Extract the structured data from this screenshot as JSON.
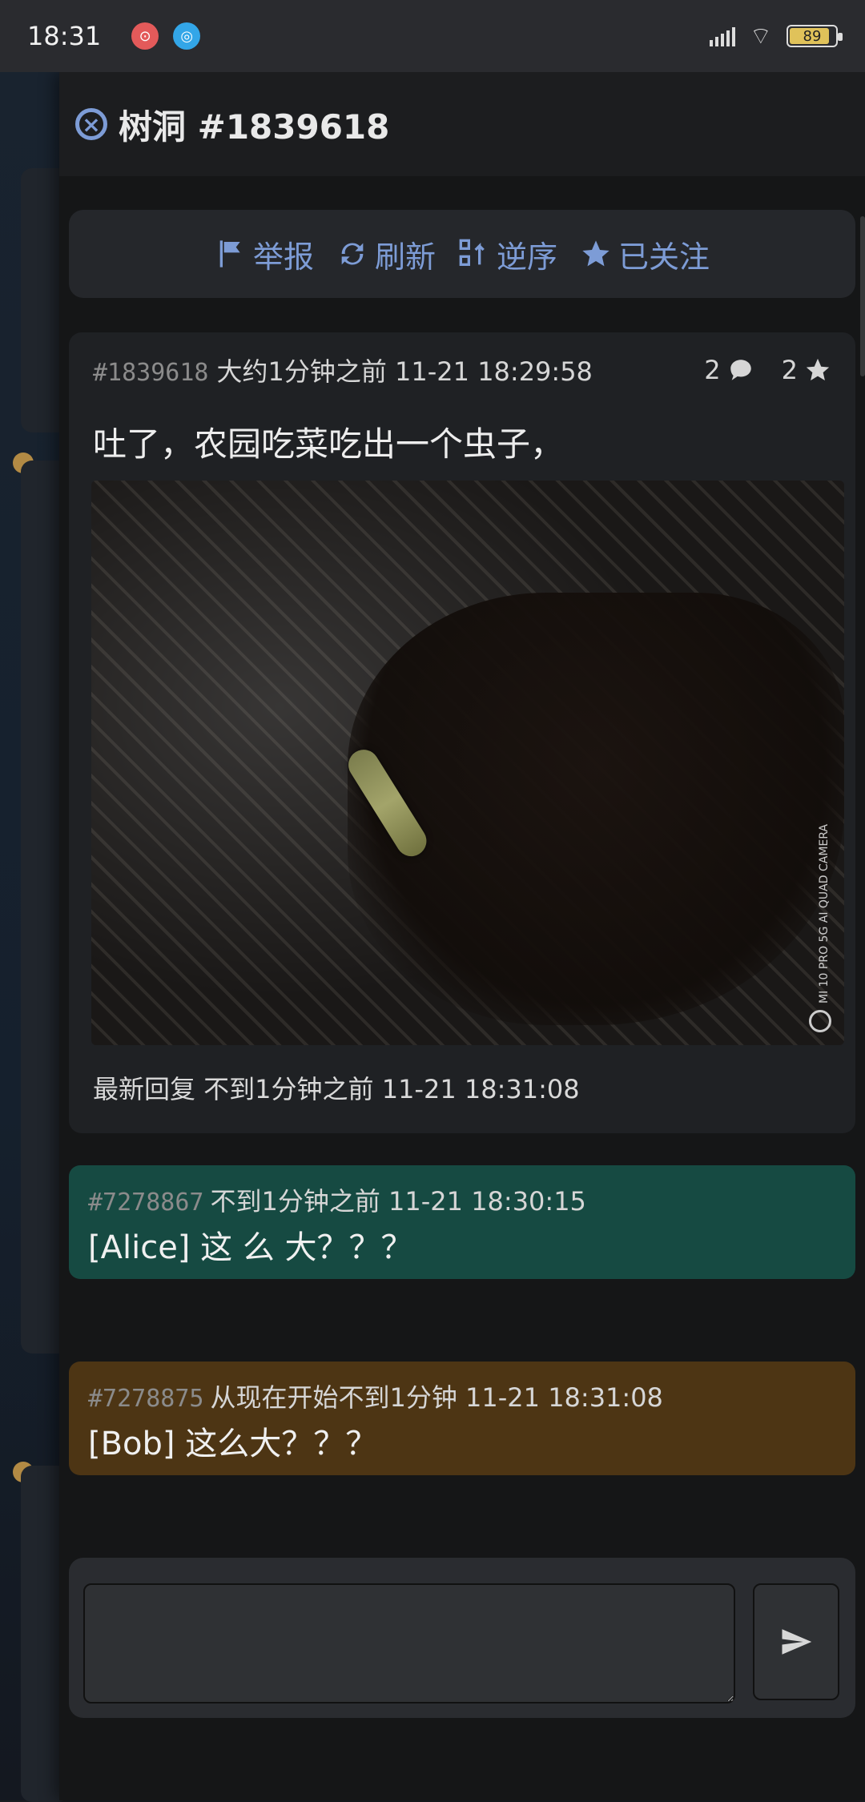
{
  "status_bar": {
    "time": "18:31",
    "battery": 89
  },
  "panel": {
    "title": "树洞 #1839618",
    "toolbar": {
      "report": "举报",
      "refresh": "刷新",
      "reverse": "逆序",
      "followed": "已关注"
    },
    "post": {
      "id": "#1839618",
      "time": "大约1分钟之前 11-21 18:29:58",
      "comment_count": "2",
      "star_count": "2",
      "text": "吐了，农园吃菜吃出一个虫子，",
      "image_watermark": "MI 10 PRO 5G\nAI QUAD CAMERA",
      "latest_reply": "最新回复 不到1分钟之前 11-21 18:31:08"
    },
    "replies": [
      {
        "id": "#7278867",
        "time": "不到1分钟之前 11-21 18:30:15",
        "text": "[Alice] 这 么 大？？？"
      },
      {
        "id": "#7278875",
        "time": "从现在开始不到1分钟 11-21 18:31:08",
        "text": "[Bob] 这么大？？？"
      }
    ],
    "compose": {
      "placeholder": ""
    }
  },
  "colors": {
    "accent": "#7d9cd6",
    "reply_alice": "#164a42",
    "reply_bob": "#4d3514"
  }
}
